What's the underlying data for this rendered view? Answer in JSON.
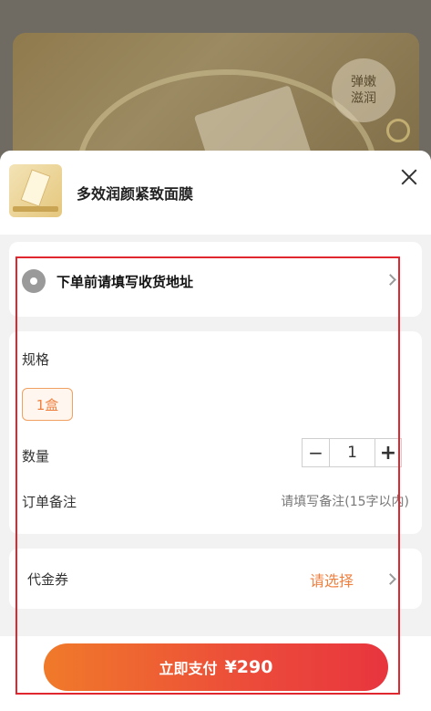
{
  "background": {
    "badge_line1": "弹嫩",
    "badge_line2": "滋润"
  },
  "product": {
    "title": "多效润颜紧致面膜"
  },
  "address": {
    "prompt": "下单前请填写收货地址"
  },
  "spec": {
    "label": "规格",
    "option_selected": "1盒",
    "quantity_label": "数量",
    "quantity_value": "1",
    "minus": "−",
    "plus": "+",
    "note_label": "订单备注",
    "note_placeholder": "请填写备注(15字以内)"
  },
  "coupon": {
    "label": "代金券",
    "value": "请选择"
  },
  "footer": {
    "pay_label": "立即支付",
    "price": "¥290"
  },
  "colors": {
    "accent": "#f08040",
    "pay_gradient_start": "#f07a2a",
    "pay_gradient_end": "#e8353e",
    "highlight_box": "#e0262e"
  }
}
